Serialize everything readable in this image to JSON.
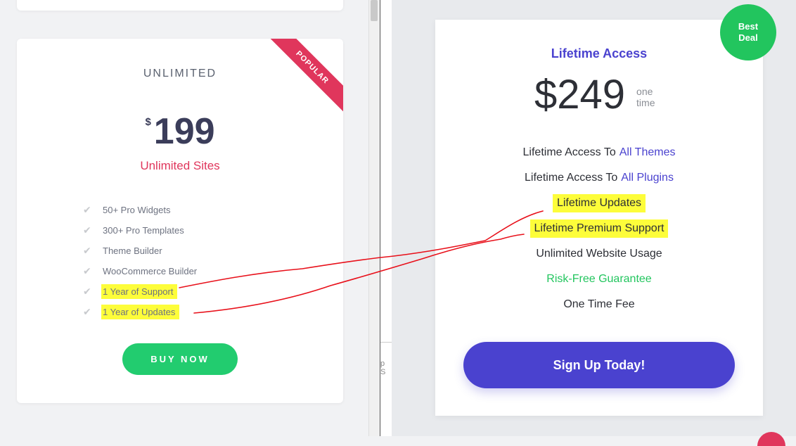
{
  "left_plan": {
    "ribbon": "POPULAR",
    "title": "UNLIMITED",
    "currency": "$",
    "price": "199",
    "subtitle": "Unlimited Sites",
    "features": [
      {
        "label": "50+ Pro Widgets",
        "highlighted": false
      },
      {
        "label": "300+ Pro Templates",
        "highlighted": false
      },
      {
        "label": "Theme Builder",
        "highlighted": false
      },
      {
        "label": "WooCommerce Builder",
        "highlighted": false
      },
      {
        "label": "1 Year of Support",
        "highlighted": true
      },
      {
        "label": "1 Year of Updates",
        "highlighted": true
      }
    ],
    "button_label": "BUY NOW"
  },
  "middle_strip": {
    "text": "p S"
  },
  "right_plan": {
    "badge_line1": "Best",
    "badge_line2": "Deal",
    "title": "Lifetime Access",
    "price": "$249",
    "unit_line1": "one",
    "unit_line2": "time",
    "features": {
      "f1_prefix": "Lifetime Access To",
      "f1_link": "All Themes",
      "f2_prefix": "Lifetime Access To",
      "f2_link": "All Plugins",
      "f3": "Lifetime Updates",
      "f4": "Lifetime Premium Support",
      "f5": "Unlimited Website Usage",
      "f6": "Risk-Free Guarantee",
      "f7": "One Time Fee"
    },
    "button_label": "Sign Up Today!"
  },
  "colors": {
    "accent_purple": "#4a42cf",
    "popular_red": "#e0365c",
    "buy_green": "#22cc6f",
    "badge_green": "#22c55e",
    "highlight_yellow": "#fdfd3a",
    "annotation_red": "#e8101a"
  },
  "icons": {
    "feature_check": "check-icon"
  }
}
